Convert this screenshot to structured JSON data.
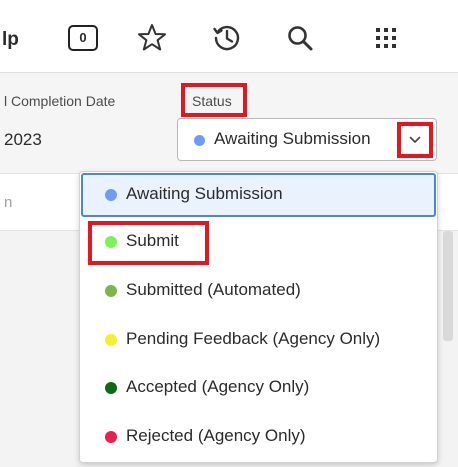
{
  "header": {
    "help_partial": "lp",
    "notification_count": "0",
    "icons": [
      "notification-count-badge",
      "star-icon",
      "history-icon",
      "search-icon",
      "apps-grid-icon"
    ]
  },
  "form": {
    "completion_label": "l Completion Date",
    "completion_value": "2023",
    "status_label": "Status",
    "status_value": "Awaiting Submission",
    "status_color": "#6f9cf3"
  },
  "background": {
    "ghost_text": "n"
  },
  "dropdown": {
    "items": [
      {
        "label": "Awaiting Submission",
        "color": "#6f9cf3",
        "selected": true
      },
      {
        "label": "Submit",
        "color": "#7df25a"
      },
      {
        "label": "Submitted (Automated)",
        "color": "#7db74b"
      },
      {
        "label": "Pending Feedback (Agency Only)",
        "color": "#f7ef2c"
      },
      {
        "label": "Accepted (Agency Only)",
        "color": "#0b6b10"
      },
      {
        "label": "Rejected (Agency Only)",
        "color": "#ea1f4d"
      }
    ]
  },
  "highlight_color": "#e4161f"
}
